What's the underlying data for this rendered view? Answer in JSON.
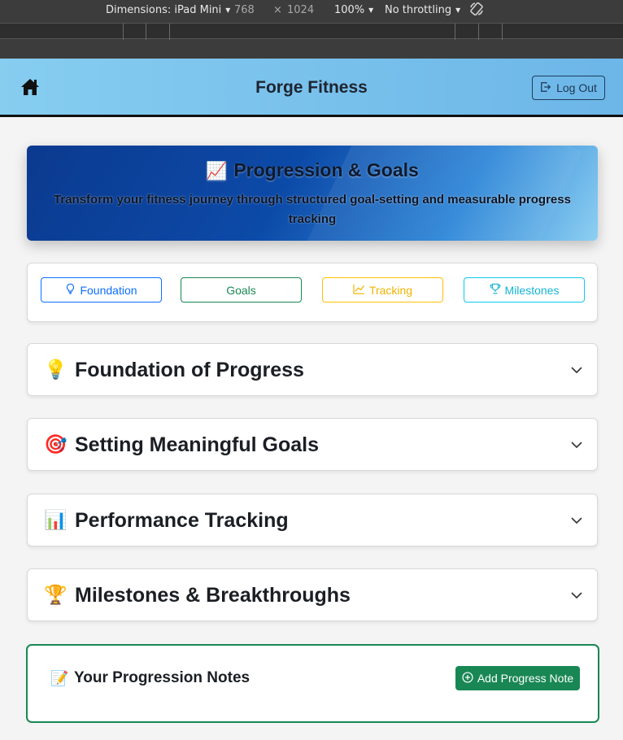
{
  "devtools": {
    "dimensions_label": "Dimensions: iPad Mini",
    "width": "768",
    "times": "×",
    "height": "1024",
    "zoom": "100%",
    "throttling": "No throttling",
    "rotate_icon": "rotate-icon"
  },
  "header": {
    "brand": "Forge Fitness",
    "home_icon": "home-icon",
    "logout_label": "Log Out",
    "logout_icon": "logout-icon"
  },
  "hero": {
    "emoji": "📈",
    "title": "Progression & Goals",
    "subtitle": "Transform your fitness journey through structured goal-setting and measurable progress tracking"
  },
  "quick_nav": [
    {
      "label": "Foundation",
      "icon": "lightbulb-icon",
      "color": "#0d6efd"
    },
    {
      "label": "Goals",
      "icon": "",
      "color": "#198754"
    },
    {
      "label": "Tracking",
      "icon": "graph-up-icon",
      "color": "#ffc107"
    },
    {
      "label": "Milestones",
      "icon": "trophy-icon",
      "color": "#0dcaf0"
    }
  ],
  "sections": [
    {
      "emoji": "💡",
      "title": "Foundation of Progress"
    },
    {
      "emoji": "🎯",
      "title": "Setting Meaningful Goals"
    },
    {
      "emoji": "📊",
      "title": "Performance Tracking"
    },
    {
      "emoji": "🏆",
      "title": "Milestones & Breakthroughs"
    }
  ],
  "notes": {
    "emoji": "📝",
    "title": "Your Progression Notes",
    "add_label": "Add Progress Note",
    "add_icon": "plus-circle-icon"
  },
  "colors": {
    "primary": "#0d6efd",
    "success": "#198754",
    "warning": "#ffc107",
    "info": "#0dcaf0",
    "header_bg": "#7ac2ee"
  }
}
